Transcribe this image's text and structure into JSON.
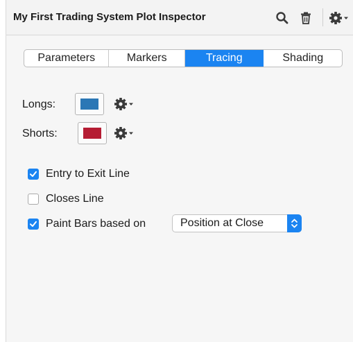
{
  "header": {
    "title": "My First Trading System Plot Inspector",
    "icons": [
      "search-icon",
      "trash-icon",
      "gear-dropdown-icon"
    ]
  },
  "tabs": [
    {
      "label": "Parameters",
      "active": false
    },
    {
      "label": "Markers",
      "active": false
    },
    {
      "label": "Tracing",
      "active": true
    },
    {
      "label": "Shading",
      "active": false
    }
  ],
  "tracing": {
    "longs": {
      "label": "Longs:",
      "color": "#2b77b5"
    },
    "shorts": {
      "label": "Shorts:",
      "color": "#b51c33"
    },
    "options": [
      {
        "label": "Entry to Exit Line",
        "checked": true
      },
      {
        "label": "Closes Line",
        "checked": false
      },
      {
        "label": "Paint Bars based on",
        "checked": true
      }
    ],
    "paint_mode": {
      "selected": "Position at Close"
    }
  },
  "colors": {
    "accent": "#1b84f1"
  }
}
